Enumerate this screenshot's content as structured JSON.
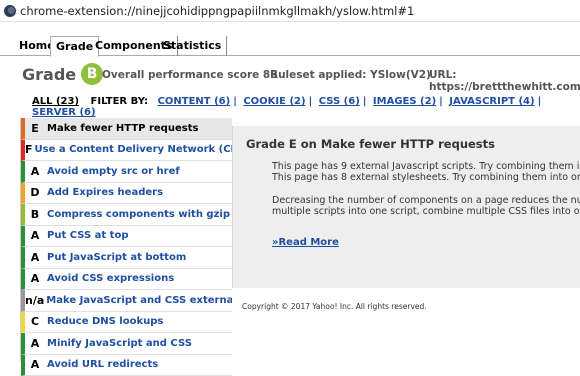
{
  "browser": {
    "url": "chrome-extension://ninejjcohidippngpapiilnmkgllmakh/yslow.html#1"
  },
  "tabs": [
    "Home",
    "Grade",
    "Components",
    "Statistics"
  ],
  "grade": {
    "title": "Grade",
    "letter": "B",
    "score_text": "Overall performance score 86",
    "ruleset_text": "Ruleset applied: YSlow(V2)",
    "url_text": "URL: https://brettthewhitt.com/"
  },
  "filters": {
    "all": "ALL (23)",
    "label": "FILTER BY:",
    "items": [
      "CONTENT (6)",
      "COOKIE (2)",
      "CSS (6)",
      "IMAGES (2)",
      "JAVASCRIPT (4)",
      "SERVER (6)"
    ]
  },
  "rules": [
    {
      "grade": "E",
      "label": "Make fewer HTTP requests",
      "color": "#e06a1f"
    },
    {
      "grade": "F",
      "label": "Use a Content Delivery Network (CDN)",
      "color": "#d82c2c"
    },
    {
      "grade": "A",
      "label": "Avoid empty src or href",
      "color": "#2d8f3a"
    },
    {
      "grade": "D",
      "label": "Add Expires headers",
      "color": "#f1a22a"
    },
    {
      "grade": "B",
      "label": "Compress components with gzip",
      "color": "#8fbf3c"
    },
    {
      "grade": "A",
      "label": "Put CSS at top",
      "color": "#2d8f3a"
    },
    {
      "grade": "A",
      "label": "Put JavaScript at bottom",
      "color": "#2d8f3a"
    },
    {
      "grade": "A",
      "label": "Avoid CSS expressions",
      "color": "#2d8f3a"
    },
    {
      "grade": "n/a",
      "label": "Make JavaScript and CSS external",
      "color": "#999999"
    },
    {
      "grade": "C",
      "label": "Reduce DNS lookups",
      "color": "#f0d83a"
    },
    {
      "grade": "A",
      "label": "Minify JavaScript and CSS",
      "color": "#2d8f3a"
    },
    {
      "grade": "A",
      "label": "Avoid URL redirects",
      "color": "#2d8f3a"
    }
  ],
  "detail": {
    "heading": "Grade E on Make fewer HTTP requests",
    "line1": "This page has 9 external Javascript scripts. Try combining them into o",
    "line2": "This page has 8 external stylesheets. Try combining them into one.",
    "line3": "Decreasing the number of components on a page reduces the number",
    "line4": "multiple scripts into one script, combine multiple CSS files into one sty",
    "read_more": "»Read More"
  },
  "footer": {
    "copyright": "Copyright © 2017 Yahoo! Inc. All rights reserved."
  }
}
